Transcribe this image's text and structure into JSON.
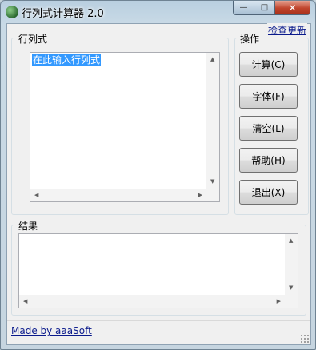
{
  "window": {
    "title": "行列式计算器 2.0"
  },
  "caption": {
    "minimize": "—",
    "maximize": "□",
    "close": "✕"
  },
  "header": {
    "update_link": "检查更新"
  },
  "input_group": {
    "label": "行列式",
    "text_value": "在此输入行列式"
  },
  "actions_group": {
    "label": "操作",
    "buttons": [
      {
        "label": "计算(C)"
      },
      {
        "label": "字体(F)"
      },
      {
        "label": "清空(L)"
      },
      {
        "label": "帮助(H)"
      },
      {
        "label": "退出(X)"
      }
    ]
  },
  "result_group": {
    "label": "结果",
    "text_value": ""
  },
  "footer": {
    "credit_link": "Made by aaaSoft"
  },
  "icons": {
    "app": "app-globe-icon",
    "grip": "resize-grip-icon"
  },
  "colors": {
    "link": "#0a1a8c",
    "selection": "#3399ff",
    "close_button": "#c0442c"
  }
}
